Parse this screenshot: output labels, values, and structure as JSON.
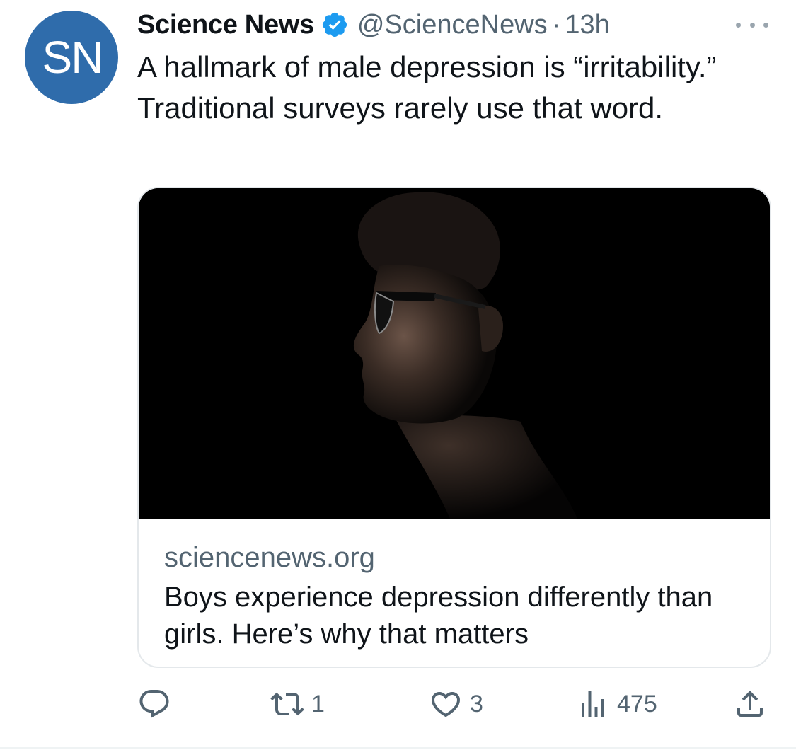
{
  "tweet": {
    "avatar_initials": "SN",
    "display_name": "Science News",
    "handle": "@ScienceNews",
    "separator": "·",
    "time": "13h",
    "verified": true,
    "text": "A hallmark of male depression is “irritability.” Traditional surveys rarely use that word."
  },
  "card": {
    "domain": "sciencenews.org",
    "title": "Boys experience depression differently than girls. Here’s why that matters"
  },
  "actions": {
    "reply_count": "",
    "retweet_count": "1",
    "like_count": "3",
    "views_count": "475"
  },
  "icons": {
    "verified": "verified-badge-icon",
    "more": "more-dots-icon",
    "reply": "reply-icon",
    "retweet": "retweet-icon",
    "like": "heart-icon",
    "views": "views-icon",
    "share": "share-icon"
  },
  "colors": {
    "accent": "#1d9bf0",
    "avatar_bg": "#2f6cab",
    "text_primary": "#0f1419",
    "text_secondary": "#536471"
  }
}
